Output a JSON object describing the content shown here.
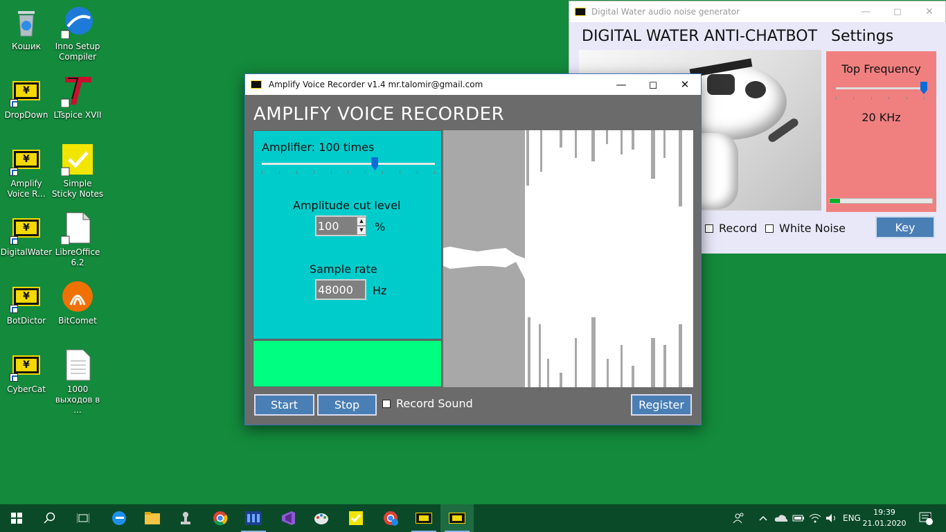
{
  "desktop": {
    "icons": [
      {
        "label": "Кошик",
        "icon": "recycle-bin-icon"
      },
      {
        "label": "Inno Setup Compiler",
        "icon": "inno-setup-icon"
      },
      {
        "label": "DropDown",
        "icon": "yen-app-icon"
      },
      {
        "label": "LTspice XVII",
        "icon": "ltspice-icon"
      },
      {
        "label": "Amplify Voice R...",
        "icon": "yen-app-icon"
      },
      {
        "label": "Simple Sticky Notes",
        "icon": "sticky-notes-icon"
      },
      {
        "label": "DigitalWater",
        "icon": "yen-app-icon"
      },
      {
        "label": "LibreOffice 6.2",
        "icon": "libreoffice-icon"
      },
      {
        "label": "BotDictor",
        "icon": "yen-app-icon"
      },
      {
        "label": "BitComet",
        "icon": "bitcomet-icon"
      },
      {
        "label": "CyberCat",
        "icon": "yen-app-icon"
      },
      {
        "label": "1000 выходов в ...",
        "icon": "text-file-icon"
      }
    ]
  },
  "digital_water": {
    "title": "Digital Water audio noise generator",
    "heading": "DIGITAL WATER ANTI-CHATBOT",
    "settings_label": "Settings",
    "top_frequency_label": "Top Frequency",
    "frequency_value": "20 KHz",
    "level_fraction": 0.1,
    "record_label": "Record",
    "white_noise_label": "White Noise",
    "key_label": "Key",
    "panel_color": "#f08080"
  },
  "amplify": {
    "title": "Amplify Voice Recorder v1.4 mr.talomir@gmail.com",
    "heading": "AMPLIFY VOICE RECORDER",
    "amplifier_label": "Amplifier:  100 times",
    "amplifier_slider_fraction": 0.66,
    "amplitude_cut_label": "Amplitude cut level",
    "amplitude_cut_value": "100",
    "percent_unit": "%",
    "sample_rate_label": "Sample rate",
    "sample_rate_value": "48000",
    "hz_unit": "Hz",
    "start_label": "Start",
    "stop_label": "Stop",
    "record_sound_label": "Record Sound",
    "register_label": "Register",
    "panel_color": "#00cccc",
    "status_color": "#00ff80"
  },
  "taskbar": {
    "language": "ENG",
    "time": "19:39",
    "date": "21.01.2020",
    "notifications": "3"
  }
}
